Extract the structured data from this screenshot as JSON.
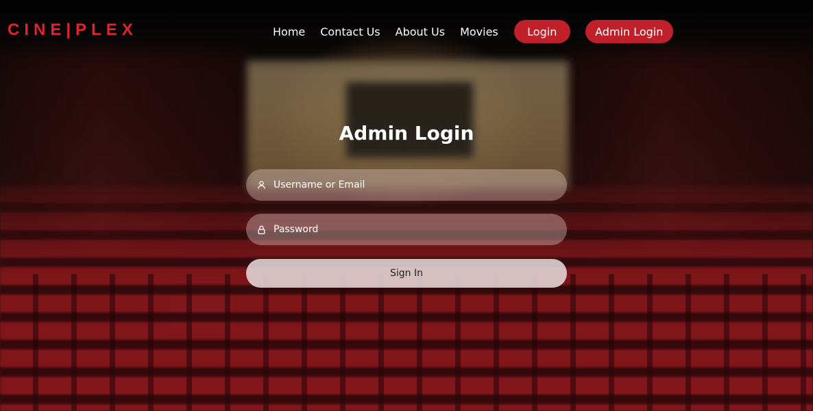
{
  "brand": {
    "logo_text": "CINE|PLEX",
    "accent_color": "#e0242f"
  },
  "nav": {
    "links": [
      "Home",
      "Contact Us",
      "About Us",
      "Movies"
    ],
    "login_label": "Login",
    "admin_login_label": "Admin Login",
    "button_color": "#c0202a"
  },
  "form": {
    "title": "Admin Login",
    "username_placeholder": "Username or Email",
    "username_icon": "user-icon",
    "password_placeholder": "Password",
    "password_icon": "lock-icon",
    "submit_label": "Sign In"
  }
}
